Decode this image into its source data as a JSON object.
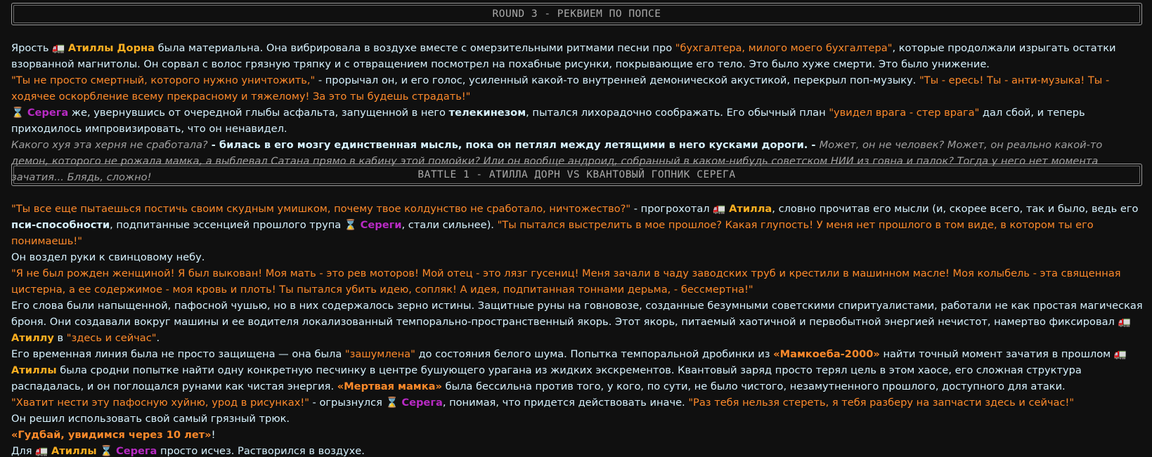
{
  "round_banner": "ROUND 3 - РЕКВИЕМ ПО ПОПСЕ",
  "battle_banner": "BATTLE 1 - АТИЛЛА ДОРН VS КВАНТОВЫЙ ГОПНИК СЕРЕГА",
  "icons": {
    "truck": "🚛",
    "hourglass": "⌛"
  },
  "colors": {
    "quote": "#ff8a2a",
    "atilla": "#ffb020",
    "serega": "#b82ac4",
    "text": "#d6f2ff",
    "thought": "#a0a0a0"
  },
  "s1": {
    "p1": {
      "t1": "Ярость ",
      "name1": "Атиллы Дорна",
      "t2": " была материальна. Она вибрировала в воздухе вместе с омерзительными ритмами песни про ",
      "q1": "\"бухгалтера, милого моего бухгалтера\"",
      "t3": ", которые продолжали изрыгать остатки взорванной магнитолы. Он сорвал с волос грязную тряпку и с отвращением посмотрел на похабные рисунки, покрывающие его тело. Это было хуже смерти. Это было унижение."
    },
    "p2": {
      "q1": "\"Ты не просто смертный, которого нужно уничтожить,\"",
      "t1": " - прорычал он, и его голос, усиленный какой-то внутренней демонической акустикой, перекрыл поп-музыку. ",
      "q2": "\"Ты - ересь! Ты - анти-музыка! Ты - ходячее оскорбление всему прекрасному и тяжелому! За это ты будешь страдать!\""
    },
    "p3": {
      "name1": "Серега",
      "t1": " же, увернувшись от очередной глыбы асфальта, запущенной в него ",
      "b1": "телекинезом",
      "t2": ", пытался лихорадочно соображать. Его обычный план ",
      "q1": "\"увидел врага - стер врага\"",
      "t3": " дал сбой, и теперь приходилось импровизировать, что он ненавидел."
    },
    "p4": {
      "i1": "Какого хуя эта херня не сработала?",
      "b1": " - билась в его мозгу единственная мысль, пока он петлял между летящими в него кусками дороги. - ",
      "i2": "Может, он не человек? Может, он реально какой-то демон, которого не рожала мамка, а выблевал Сатана прямо в кабину этой помойки? Или он вообще андроид, собранный в каком-нибудь советском НИИ из говна и палок? Тогда у него нет момента зачатия... Блядь, сложно!"
    }
  },
  "s2": {
    "p1": {
      "q1": "\"Ты все еще пытаешься постичь своим скудным умишком, почему твое колдунство не сработало, ничтожество?\"",
      "t1": " - прогрохотал ",
      "name1": "Атилла",
      "t2": ", словно прочитав его мысли (и, скорее всего, так и было, ведь его ",
      "b1": "пси-способности",
      "t3": ", подпитанные эссенцией прошлого трупа ",
      "name2": "Сереги",
      "t4": ", стали сильнее). ",
      "q2": "\"Ты пытался выстрелить в мое прошлое? Какая глупость! У меня нет прошлого в том виде, в котором ты его понимаешь!\""
    },
    "p2": "Он воздел руки к свинцовому небу.",
    "p3": "\"Я не был рожден женщиной! Я был выкован! Моя мать - это рев моторов! Мой отец - это лязг гусениц! Меня зачали в чаду заводских труб и крестили в машинном масле! Моя колыбель - эта священная цистерна, а ее содержимое - моя кровь и плоть! Ты пытался убить идею, сопляк! А идея, подпитанная тоннами дерьма, - бессмертна!\"",
    "p4": {
      "t1": "Его слова были напыщенной, пафосной чушью, но в них содержалось зерно истины. Защитные руны на говновозе, созданные безумными советскими спиритуалистами, работали не как простая магическая броня. Они создавали вокруг машины и ее водителя локализованный темпорально-пространственный якорь. Этот якорь, питаемый хаотичной и первобытной энергией нечистот, намертво фиксировал ",
      "name1": "Атиллу",
      "t2": " в ",
      "q1": "\"здесь и сейчас\"",
      "t3": "."
    },
    "p5": {
      "t1": "Его временная линия была не просто защищена — она была ",
      "q1": "\"зашумлена\"",
      "t2": " до состояния белого шума. Попытка темпоральной дробинки из ",
      "qb1": "«Мамкоеба-2000»",
      "t3": " найти точный момент зачатия в прошлом ",
      "name1": "Атиллы",
      "t4": " была сродни попытке найти одну конкретную песчинку в центре бушующего урагана из жидких экскрементов. Квантовый заряд просто терял цель в этом хаосе, его сложная структура распадалась, и он поглощался рунами как чистая энергия. ",
      "qb2": "«Мертвая мамка»",
      "t5": " была бессильна против того, у кого, по сути, не было чистого, незамутненного прошлого, доступного для атаки."
    },
    "p6": {
      "q1": "\"Хватит нести эту пафосную хуйню, урод в рисунках!\"",
      "t1": " - огрызнулся ",
      "name1": "Серега",
      "t2": ", понимая, что придется действовать иначе. ",
      "q2": "\"Раз тебя нельзя стереть, я тебя разберу на запчасти здесь и сейчас!\""
    },
    "p7": "Он решил использовать свой самый грязный трюк.",
    "p8": {
      "qb1": "«Гудбай, увидимся через 10 лет»",
      "t1": "!"
    },
    "p9": {
      "t1": "Для ",
      "name1": "Атиллы",
      "name2": "Серега",
      "t2": " просто исчез. Растворился в воздухе."
    }
  }
}
